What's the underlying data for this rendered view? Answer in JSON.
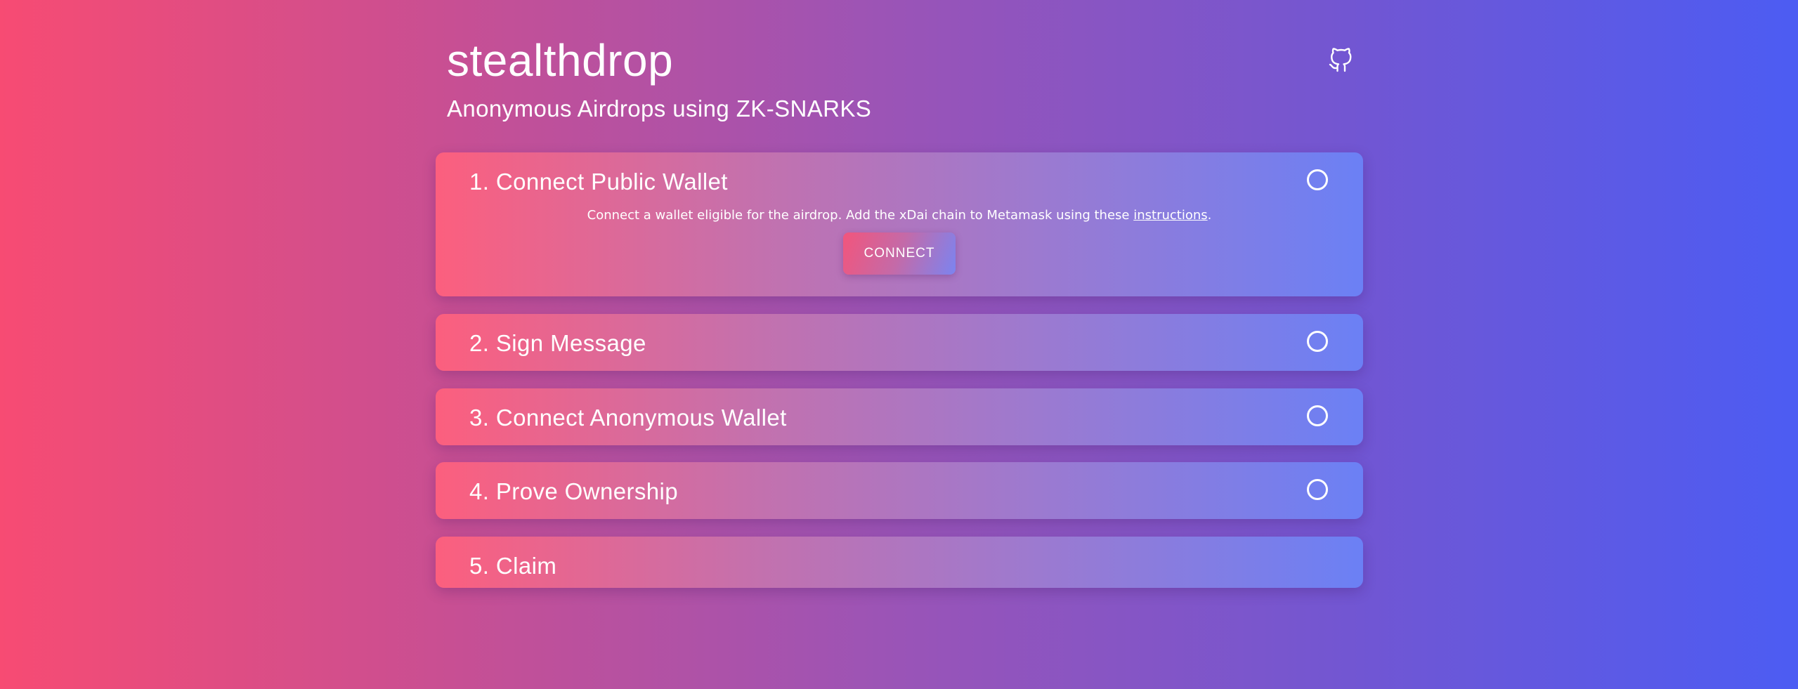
{
  "header": {
    "title": "stealthdrop",
    "subtitle": "Anonymous Airdrops using ZK-SNARKS",
    "github_icon": "github-icon"
  },
  "steps": [
    {
      "title": "1. Connect Public Wallet",
      "description_prefix": "Connect a wallet eligible for the airdrop. Add the xDai chain to Metamask using these ",
      "description_link": "instructions",
      "description_suffix": ".",
      "button_label": "CONNECT",
      "status_icon": "circle-outline-icon"
    },
    {
      "title": "2. Sign Message",
      "status_icon": "circle-outline-icon"
    },
    {
      "title": "3. Connect Anonymous Wallet",
      "status_icon": "circle-outline-icon"
    },
    {
      "title": "4. Prove Ownership",
      "status_icon": "circle-outline-icon"
    },
    {
      "title": "5. Claim"
    }
  ],
  "colors": {
    "background_start": "#f74b73",
    "background_end": "#4c5cf3",
    "card_start": "#fc5f7e",
    "card_end": "#6b80f5",
    "text": "#ffffff"
  }
}
